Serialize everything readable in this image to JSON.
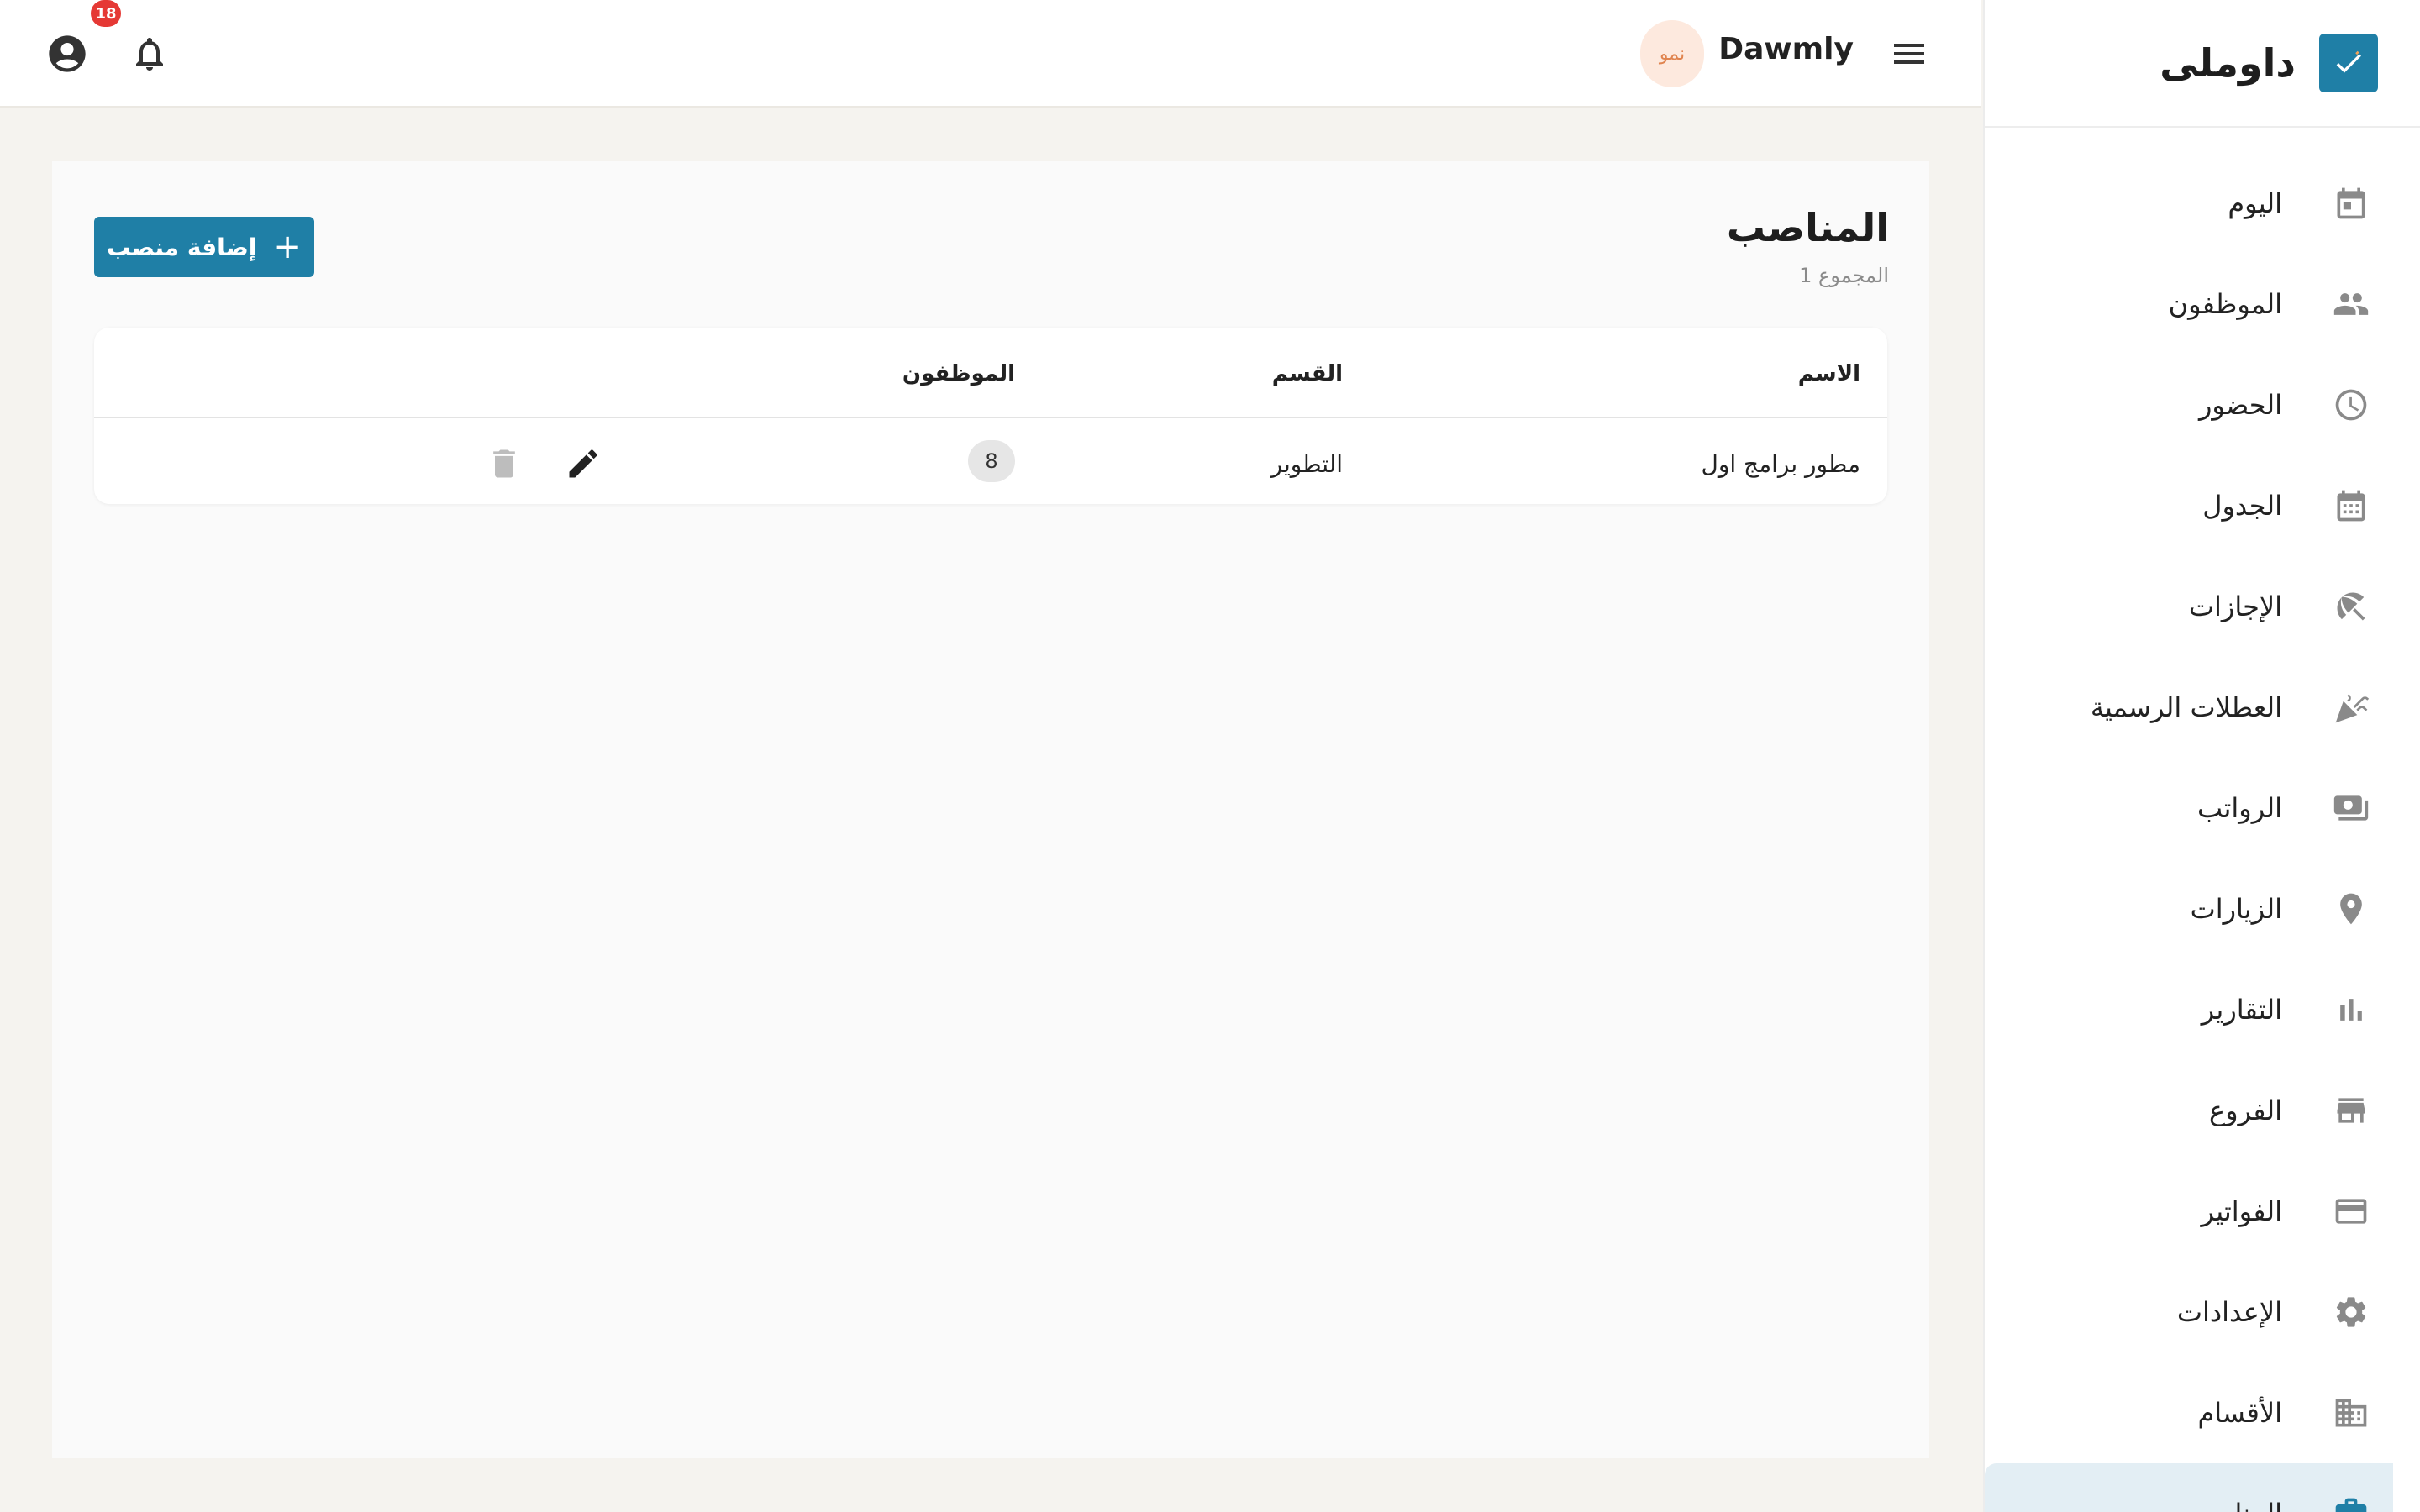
{
  "brand": {
    "name": "داوملى",
    "logo_icon": "check-icon",
    "accent_color": "#1f7fa6"
  },
  "sidebar": {
    "items": [
      {
        "label": "اليوم",
        "icon": "calendar-today-icon"
      },
      {
        "label": "الموظفون",
        "icon": "people-icon"
      },
      {
        "label": "الحضور",
        "icon": "clock-icon"
      },
      {
        "label": "الجدول",
        "icon": "calendar-grid-icon"
      },
      {
        "label": "الإجازات",
        "icon": "beach-umbrella-icon"
      },
      {
        "label": "العطلات الرسمية",
        "icon": "celebration-icon"
      },
      {
        "label": "الرواتب",
        "icon": "payments-icon"
      },
      {
        "label": "الزيارات",
        "icon": "location-pin-icon"
      },
      {
        "label": "التقارير",
        "icon": "bar-chart-icon"
      },
      {
        "label": "الفروع",
        "icon": "store-icon"
      },
      {
        "label": "الفواتير",
        "icon": "credit-card-icon"
      },
      {
        "label": "الإعدادات",
        "icon": "settings-gear-icon"
      },
      {
        "label": "الأقسام",
        "icon": "building-icon"
      },
      {
        "label": "المناصب",
        "icon": "briefcase-icon",
        "active": true
      }
    ]
  },
  "topbar": {
    "org_name": "Dawmly",
    "org_badge": "نمو",
    "notification_count": "18"
  },
  "page": {
    "title": "المناصب",
    "subtitle": "1 المجموع",
    "add_button_label": "إضافة منصب"
  },
  "table": {
    "columns": {
      "name": "الاسم",
      "department": "القسم",
      "employees": "الموظفون"
    },
    "rows": [
      {
        "name": "مطور برامج اول",
        "department": "التطوير",
        "employees": "8"
      }
    ]
  }
}
